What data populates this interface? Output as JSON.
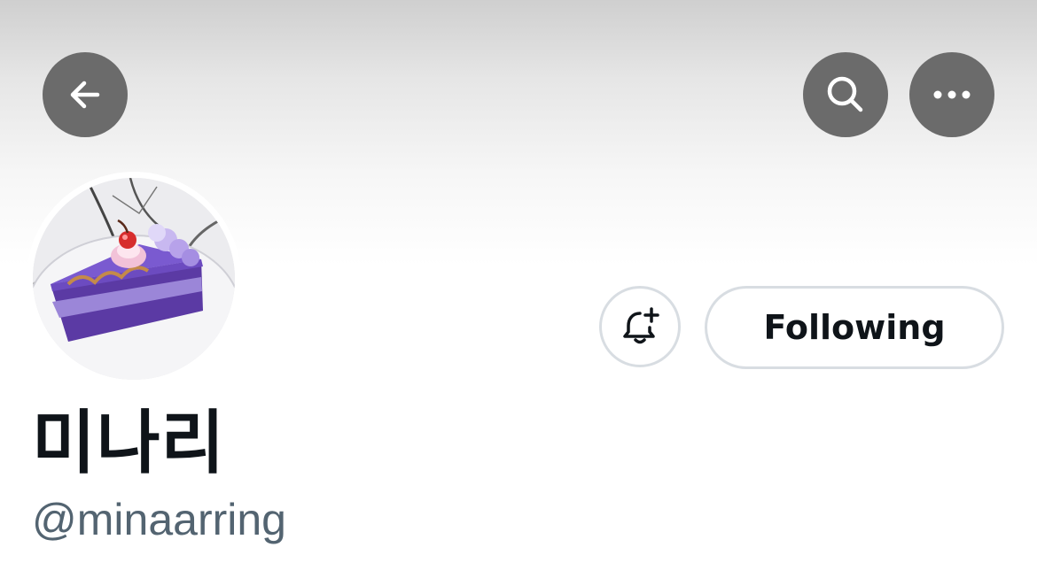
{
  "header": {
    "back_icon": "arrow-left-icon",
    "search_icon": "search-icon",
    "more_icon": "more-horizontal-icon",
    "button_color": "#6b6b6b"
  },
  "profile": {
    "avatar_description": "purple-cake-slice-avatar",
    "display_name": "미나리",
    "handle": "@minaarring"
  },
  "actions": {
    "notify_icon": "bell-plus-icon",
    "following_label": "Following"
  },
  "colors": {
    "text_primary": "#0f1419",
    "text_secondary": "#536471",
    "border": "#d8dde2"
  }
}
